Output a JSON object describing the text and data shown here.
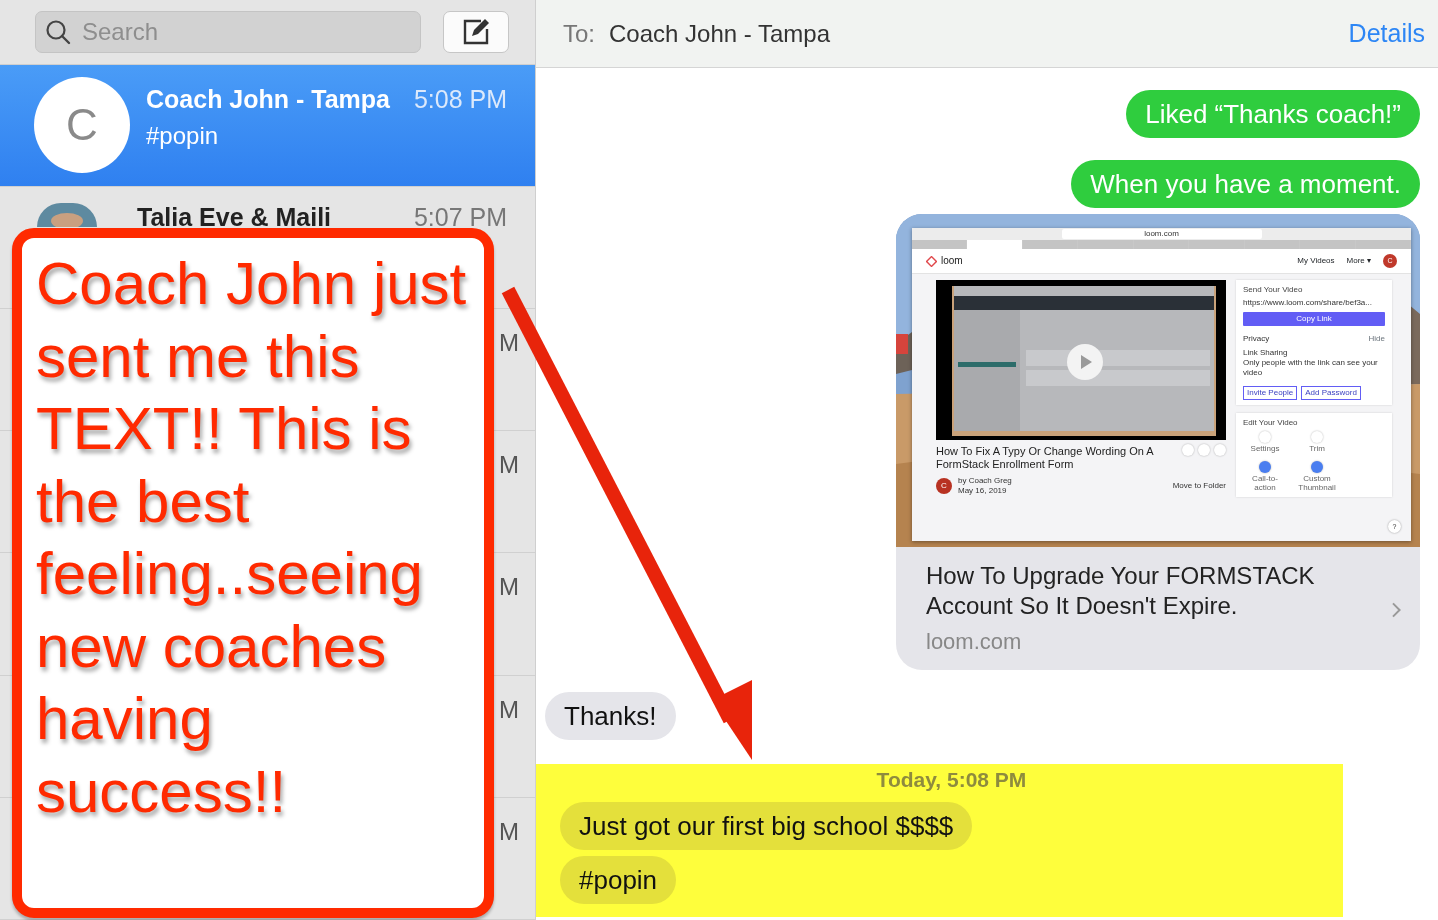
{
  "sidebar": {
    "search": {
      "placeholder": "Search"
    },
    "conversations": [
      {
        "kind": "full",
        "name": "Coach John - Tampa",
        "time": "5:08 PM",
        "preview": "#popin",
        "initial": "C",
        "selected": true
      },
      {
        "kind": "partial",
        "name": "Talia Eve & Maili",
        "time": "5:07 PM",
        "selected": false
      },
      {
        "kind": "hidden",
        "time": "M",
        "selected": false
      },
      {
        "kind": "hidden",
        "time": "M",
        "selected": false
      },
      {
        "kind": "hidden",
        "time": "M",
        "selected": false
      },
      {
        "kind": "hidden",
        "time": "M",
        "selected": false
      },
      {
        "kind": "hidden",
        "time": "M",
        "selected": false
      }
    ]
  },
  "header": {
    "to_label": "To:",
    "recipient": "Coach John - Tampa",
    "details": "Details"
  },
  "thread": {
    "messages": [
      {
        "kind": "sent",
        "text": "Liked “Thanks coach!”"
      },
      {
        "kind": "sent",
        "text": "When you have a moment."
      },
      {
        "kind": "link",
        "title": "How To Upgrade Your FORMSTACK Account So It Doesn't Expire.",
        "domain": "loom.com",
        "screenshot": {
          "address": "loom.com",
          "tabs": [
            {
              "selected": false
            },
            {
              "selected": true
            },
            {
              "selected": false
            },
            {
              "selected": false
            },
            {
              "selected": false
            },
            {
              "selected": false
            },
            {
              "selected": false
            },
            {
              "selected": false
            },
            {
              "selected": false
            }
          ],
          "brand": "loom",
          "nav": [
            "My Videos",
            "More ▾"
          ],
          "avatar": "C",
          "video_title": "How To Fix A Typy Or Change Wording On A FormStack Enrollment Form",
          "author": "by Coach Greg",
          "date": "May 16, 2019",
          "author_initial": "C",
          "move": "Move to Folder",
          "send": {
            "title": "Send Your Video",
            "url": "https://www.loom.com/share/bef3a...",
            "copy": "Copy Link",
            "privacy": "Privacy",
            "hide": "Hide",
            "sharing": "Link Sharing",
            "sharing_note": "Only people with the link can see your video",
            "invite": "Invite People",
            "password": "Add Password"
          },
          "edit": {
            "title": "Edit Your Video",
            "tools": [
              "Settings",
              "Trim",
              "Call-to-action",
              "Custom Thumbnail"
            ]
          },
          "help": "?"
        }
      },
      {
        "kind": "received",
        "text": "Thanks!"
      }
    ],
    "highlight": {
      "timestamp": "Today, 5:08 PM",
      "messages": [
        {
          "kind": "received",
          "text": "Just got our first big school $$$$"
        },
        {
          "kind": "received",
          "text": "#popin"
        }
      ]
    }
  },
  "annotation": {
    "text": "Coach John just sent me this TEXT!! This is the best feeling..seeing new coaches having success!!"
  }
}
